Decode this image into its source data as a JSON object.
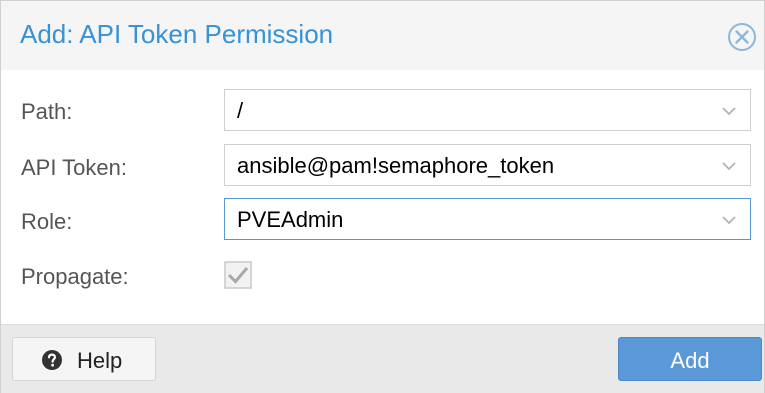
{
  "dialog": {
    "title": "Add: API Token Permission",
    "close_icon": "close-circle-icon"
  },
  "form": {
    "fields": [
      {
        "label": "Path:",
        "value": "/"
      },
      {
        "label": "API Token:",
        "value": "ansible@pam!semaphore_token"
      },
      {
        "label": "Role:",
        "value": "PVEAdmin"
      }
    ],
    "propagate": {
      "label": "Propagate:",
      "checked": true,
      "disabled": true
    }
  },
  "footer": {
    "help_label": "Help",
    "add_label": "Add"
  },
  "colors": {
    "title": "#3892d4",
    "primary_button": "#5a98d8",
    "focused_border": "#5a96cf"
  }
}
